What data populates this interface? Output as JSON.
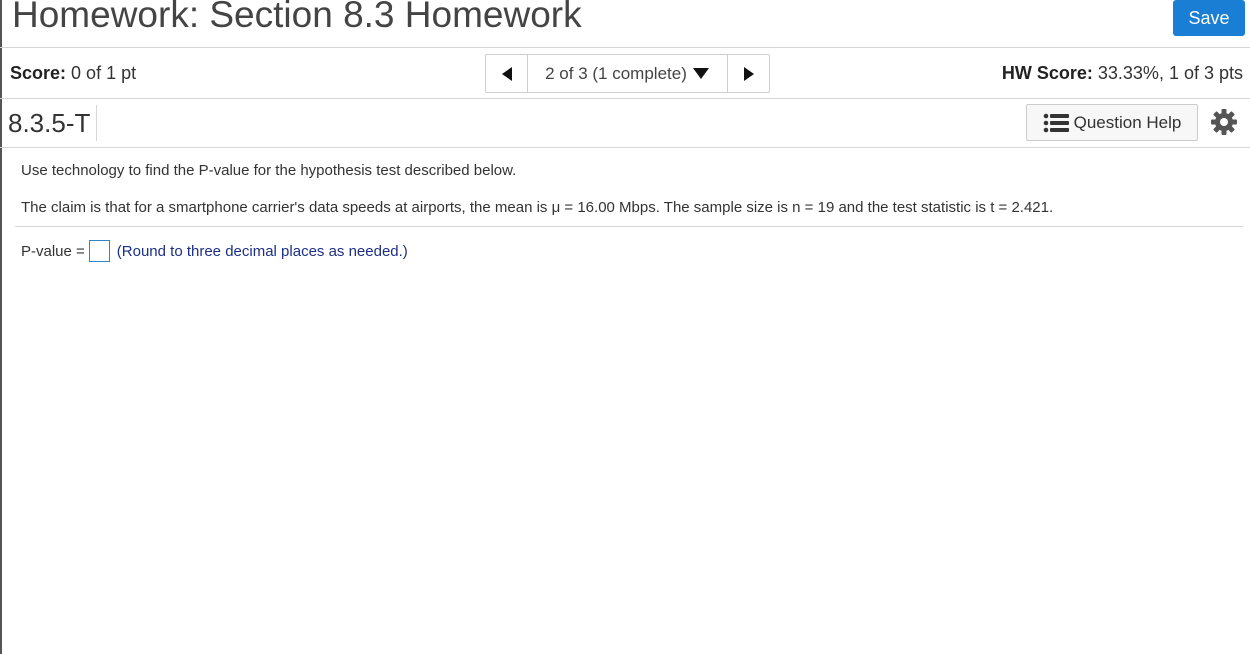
{
  "header": {
    "title": "Homework: Section 8.3 Homework",
    "save_label": "Save"
  },
  "score_bar": {
    "score_label": "Score:",
    "score_value": "0 of 1 pt",
    "nav_position": "2 of 3 (1 complete)",
    "hw_score_label": "HW Score:",
    "hw_score_value": "33.33%, 1 of 3 pts"
  },
  "question": {
    "id": "8.3.5-T",
    "help_label": "Question Help",
    "instruction": "Use technology to find the P-value for the hypothesis test described below.",
    "claim": "The claim is that for a smartphone carrier's data speeds at airports, the mean is μ = 16.00 Mbps. The sample size is n = 19 and the test statistic is t = 2.421.",
    "answer_label": "P-value =",
    "answer_value": "",
    "hint": "(Round to three decimal places as needed.)"
  },
  "colors": {
    "save_button": "#1a7ed4",
    "input_border": "#2e86c9",
    "hint_text": "#1d2f86"
  },
  "icons": [
    "prev-arrow-icon",
    "dropdown-caret-icon",
    "next-arrow-icon",
    "list-icon",
    "gear-icon"
  ]
}
